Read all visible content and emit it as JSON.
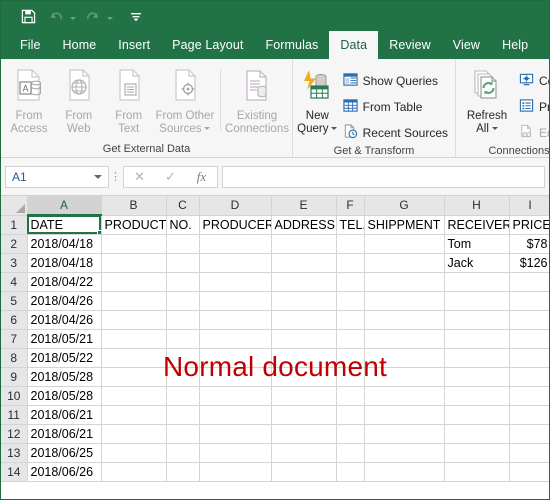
{
  "window": {
    "quick_access": [
      {
        "name": "save-button",
        "icon": "save-icon",
        "enabled": true
      },
      {
        "name": "undo-button",
        "icon": "undo-icon",
        "enabled": false
      },
      {
        "name": "redo-button",
        "icon": "redo-icon",
        "enabled": false
      },
      {
        "name": "customize-quick-access-button",
        "icon": "customize-toolbar-icon",
        "enabled": true
      }
    ]
  },
  "tabs": [
    {
      "label": "File",
      "active": false
    },
    {
      "label": "Home",
      "active": false
    },
    {
      "label": "Insert",
      "active": false
    },
    {
      "label": "Page Layout",
      "active": false
    },
    {
      "label": "Formulas",
      "active": false
    },
    {
      "label": "Data",
      "active": true
    },
    {
      "label": "Review",
      "active": false
    },
    {
      "label": "View",
      "active": false
    },
    {
      "label": "Help",
      "active": false
    }
  ],
  "ribbon": {
    "groups": [
      {
        "title": "Get External Data",
        "big_buttons": [
          {
            "line1": "From",
            "line2": "Access",
            "icon": "from-access-icon",
            "enabled": false,
            "dropdown": false
          },
          {
            "line1": "From",
            "line2": "Web",
            "icon": "from-web-icon",
            "enabled": false,
            "dropdown": false
          },
          {
            "line1": "From",
            "line2": "Text",
            "icon": "from-text-icon",
            "enabled": false,
            "dropdown": false
          },
          {
            "line1": "From Other",
            "line2": "Sources",
            "icon": "from-other-sources-icon",
            "enabled": false,
            "dropdown": true
          },
          {
            "line1": "Existing",
            "line2": "Connections",
            "icon": "existing-connections-icon",
            "enabled": false,
            "dropdown": false
          }
        ]
      },
      {
        "title": "Get & Transform",
        "big_buttons": [
          {
            "line1": "New",
            "line2": "Query",
            "icon": "new-query-icon",
            "enabled": true,
            "dropdown": true
          }
        ],
        "small_buttons": [
          {
            "label": "Show Queries",
            "icon": "show-queries-icon",
            "enabled": true
          },
          {
            "label": "From Table",
            "icon": "from-table-icon",
            "enabled": true
          },
          {
            "label": "Recent Sources",
            "icon": "recent-sources-icon",
            "enabled": true
          }
        ]
      },
      {
        "title": "Connections",
        "big_buttons": [
          {
            "line1": "Refresh",
            "line2": "All",
            "icon": "refresh-all-icon",
            "enabled": true,
            "dropdown": true
          }
        ],
        "small_buttons": [
          {
            "label": "Conne",
            "icon": "connections-icon",
            "enabled": true
          },
          {
            "label": "Proper",
            "icon": "properties-icon",
            "enabled": true
          },
          {
            "label": "Edit Li",
            "icon": "edit-links-icon",
            "enabled": false
          }
        ]
      }
    ]
  },
  "formula_bar": {
    "name_box_value": "A1",
    "cancel_label": "✕",
    "enter_label": "✓",
    "function_label": "fx",
    "input_value": ""
  },
  "sheet": {
    "columns": [
      "A",
      "B",
      "C",
      "D",
      "E",
      "F",
      "G",
      "H",
      "I"
    ],
    "selected_column": "A",
    "selected_cell": "A1",
    "rows": [
      {
        "num": "1",
        "cells": [
          "DATE",
          "PRODUCT",
          "NO.",
          "PRODUCER",
          "ADDRESS",
          "TEL.",
          "SHIPPMENT",
          "RECEIVER",
          "PRICE"
        ]
      },
      {
        "num": "2",
        "cells": [
          "2018/04/18",
          "",
          "",
          "",
          "",
          "",
          "",
          "Tom",
          "$78"
        ]
      },
      {
        "num": "3",
        "cells": [
          "2018/04/18",
          "",
          "",
          "",
          "",
          "",
          "",
          "Jack",
          "$126"
        ]
      },
      {
        "num": "4",
        "cells": [
          "2018/04/22",
          "",
          "",
          "",
          "",
          "",
          "",
          "",
          ""
        ]
      },
      {
        "num": "5",
        "cells": [
          "2018/04/26",
          "",
          "",
          "",
          "",
          "",
          "",
          "",
          ""
        ]
      },
      {
        "num": "6",
        "cells": [
          "2018/04/26",
          "",
          "",
          "",
          "",
          "",
          "",
          "",
          ""
        ]
      },
      {
        "num": "7",
        "cells": [
          "2018/05/21",
          "",
          "",
          "",
          "",
          "",
          "",
          "",
          ""
        ]
      },
      {
        "num": "8",
        "cells": [
          "2018/05/22",
          "",
          "",
          "",
          "",
          "",
          "",
          "",
          ""
        ]
      },
      {
        "num": "9",
        "cells": [
          "2018/05/28",
          "",
          "",
          "",
          "",
          "",
          "",
          "",
          ""
        ]
      },
      {
        "num": "10",
        "cells": [
          "2018/05/28",
          "",
          "",
          "",
          "",
          "",
          "",
          "",
          ""
        ]
      },
      {
        "num": "11",
        "cells": [
          "2018/06/21",
          "",
          "",
          "",
          "",
          "",
          "",
          "",
          ""
        ]
      },
      {
        "num": "12",
        "cells": [
          "2018/06/21",
          "",
          "",
          "",
          "",
          "",
          "",
          "",
          ""
        ]
      },
      {
        "num": "13",
        "cells": [
          "2018/06/25",
          "",
          "",
          "",
          "",
          "",
          "",
          "",
          ""
        ]
      },
      {
        "num": "14",
        "cells": [
          "2018/06/26",
          "",
          "",
          "",
          "",
          "",
          "",
          "",
          ""
        ]
      }
    ],
    "right_aligned_columns": [
      8
    ]
  },
  "annotation": {
    "text": "Normal document",
    "color": "#c00000"
  },
  "colors": {
    "brand_green": "#217346",
    "ribbon_bg": "#f6f6f6",
    "header_gray": "#e6e6e6",
    "grid_line": "#d4d4d4"
  }
}
